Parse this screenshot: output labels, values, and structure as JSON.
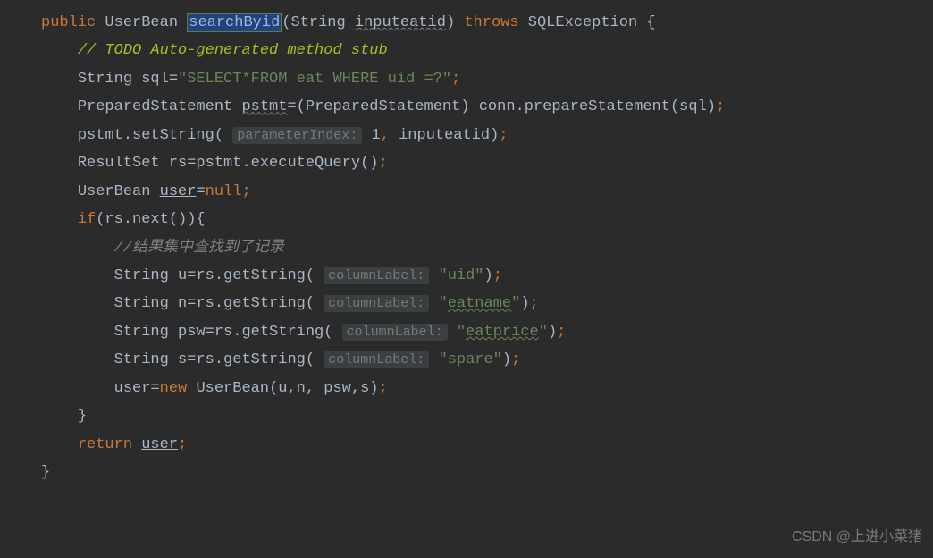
{
  "code": {
    "kw_public": "public",
    "type_userbean": "UserBean",
    "method_name": "searchByid",
    "paren_open": "(",
    "type_string": "String",
    "param_name": "inputeatid",
    "paren_close": ")",
    "kw_throws": "throws",
    "exception": "SQLException",
    "brace_open": "{",
    "comment_todo": "// TODO Auto-generated method stub",
    "decl_sql": "String sql=",
    "sql_string": "\"SELECT*FROM eat WHERE uid =?\"",
    "semi": ";",
    "type_prepstmt": "PreparedStatement",
    "var_pstmt": "pstmt",
    "eq": "=",
    "cast_open": "(",
    "cast_type": "PreparedStatement",
    "cast_close": ")",
    "conn": "conn",
    "dot": ".",
    "prep_call": "prepareStatement(sql)",
    "setstring_call": "pstmt.setString(",
    "hint_paramindex": "parameterIndex:",
    "num_1": "1",
    "comma": ",",
    "arg_inputeatid": "inputeatid)",
    "resultset_decl": "ResultSet rs=pstmt.executeQuery()",
    "userbean_decl_pre": "UserBean ",
    "var_user": "user",
    "eq_null": "=",
    "kw_null": "null",
    "kw_if": "if",
    "if_cond": "(rs.next()){",
    "comment_cn": "//结果集中查找到了记录",
    "line_u_pre": "String u=rs.getString(",
    "hint_columnlabel": "columnLabel:",
    "str_uid": "\"uid\"",
    "close_call": ")",
    "line_n_pre": "String n=rs.getString(",
    "str_eatname": "\"",
    "str_eatname_val": "eatname",
    "line_psw_pre": "String psw=rs.getString(",
    "str_eatprice_val": "eatprice",
    "line_s_pre": "String s=rs.getString(",
    "str_spare": "\"spare\"",
    "user_assign": "=",
    "kw_new": "new",
    "userbean_ctor": "UserBean(u,n, psw,s)",
    "brace_close": "}",
    "kw_return": "return"
  },
  "watermark": "CSDN @上进小菜猪"
}
